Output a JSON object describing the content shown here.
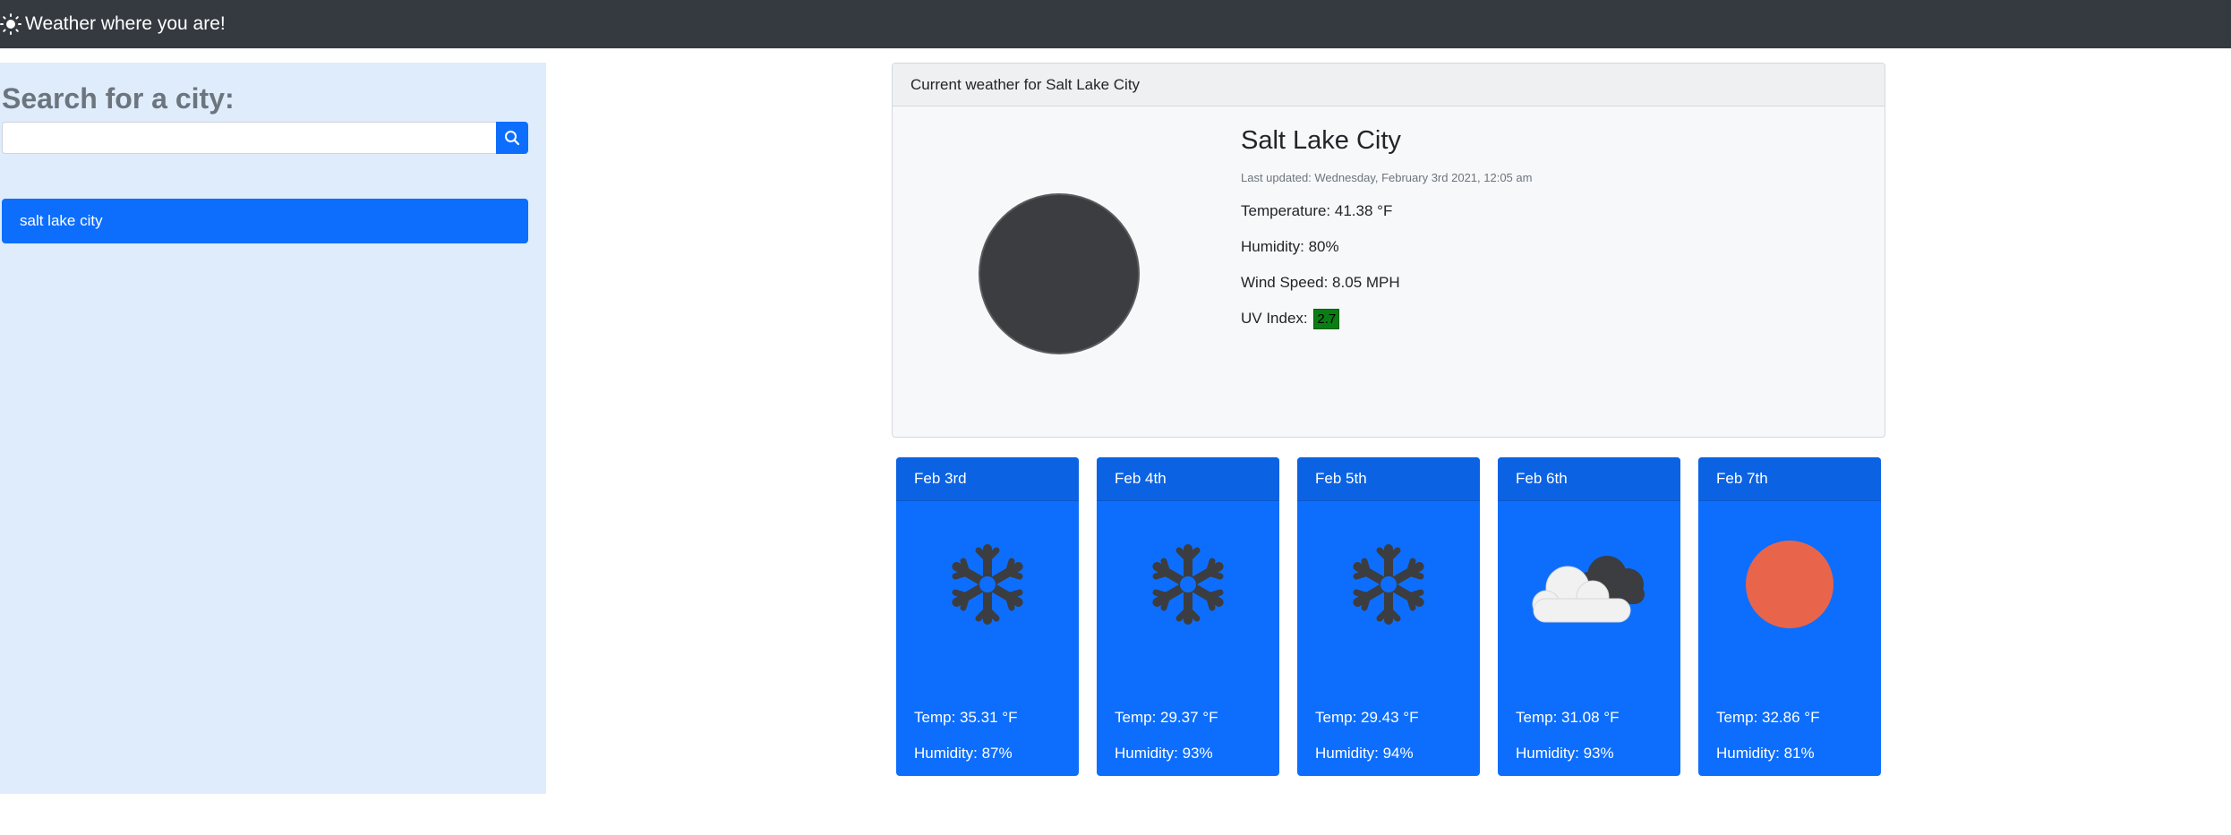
{
  "navbar": {
    "brand": "Weather where you are!",
    "icon": "sun-icon"
  },
  "sidebar": {
    "title": "Search for a city:",
    "search_value": "",
    "search_placeholder": "",
    "search_icon": "search-icon",
    "history": [
      "salt lake city"
    ]
  },
  "current": {
    "header": "Current weather for Salt Lake City",
    "city": "Salt Lake City",
    "last_updated": "Last updated: Wednesday, February 3rd 2021, 12:05 am",
    "temperature": "Temperature: 41.38 °F",
    "humidity": "Humidity: 80%",
    "wind": "Wind Speed: 8.05 MPH",
    "uv_label": "UV Index:",
    "uv_value": "2.7",
    "icon": "moon-icon",
    "uv_color": "#0a7d14"
  },
  "forecast": [
    {
      "date": "Feb 3rd",
      "icon": "snowflake-icon",
      "temp": "Temp: 35.31 °F",
      "humidity": "Humidity: 87%"
    },
    {
      "date": "Feb 4th",
      "icon": "snowflake-icon",
      "temp": "Temp: 29.37 °F",
      "humidity": "Humidity: 93%"
    },
    {
      "date": "Feb 5th",
      "icon": "snowflake-icon",
      "temp": "Temp: 29.43 °F",
      "humidity": "Humidity: 94%"
    },
    {
      "date": "Feb 6th",
      "icon": "cloudy-icon",
      "temp": "Temp: 31.08 °F",
      "humidity": "Humidity: 93%"
    },
    {
      "date": "Feb 7th",
      "icon": "sun-icon",
      "temp": "Temp: 32.86 °F",
      "humidity": "Humidity: 81%"
    }
  ],
  "colors": {
    "navbar": "#343a40",
    "primary": "#0d6efd",
    "sidebar": "#deecfc",
    "sun": "#e8654b",
    "moon": "#3c3d40"
  }
}
